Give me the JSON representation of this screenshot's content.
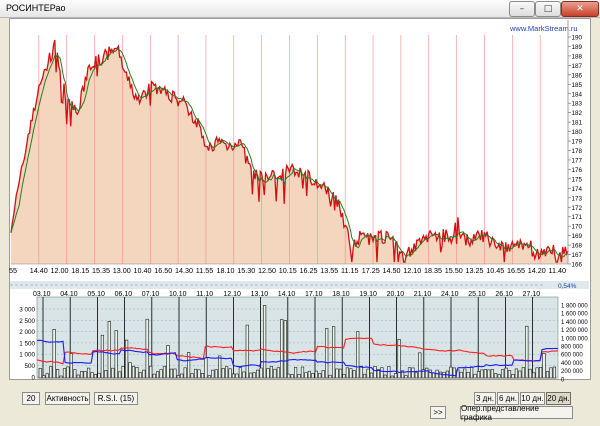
{
  "window": {
    "title": "РОСИНТЕРао"
  },
  "watermark": "www.MarkStream.ru",
  "percent_change": "0,54%",
  "price_chart": {
    "y_ticks": [
      "190",
      "189",
      "188",
      "187",
      "186",
      "185",
      "184",
      "183",
      "182",
      "181",
      "180",
      "179",
      "178",
      "177",
      "176",
      "175",
      "174",
      "173",
      "172",
      "171",
      "170",
      "169",
      "168",
      "167",
      "166"
    ],
    "x_labels": [
      "55",
      "14.40",
      "12.00",
      "18.15",
      "15.35",
      "13.00",
      "10.40",
      "16.50",
      "14.30",
      "11.55",
      "18.10",
      "15.30",
      "12.50",
      "10.15",
      "16.25",
      "13.55",
      "11.15",
      "17.25",
      "14.50",
      "12.10",
      "18.35",
      "15.50",
      "13.25",
      "10.45",
      "16.55",
      "14.20",
      "11.40"
    ]
  },
  "volume_chart": {
    "x_labels": [
      "03.10",
      "04.10",
      "05.10",
      "06.10",
      "07.10",
      "10.10",
      "11.10",
      "12.10",
      "13.10",
      "14.10",
      "17.10",
      "18.10",
      "19.10",
      "20.10",
      "21.10",
      "24.10",
      "25.10",
      "26.10",
      "27.10"
    ],
    "left_ticks": [
      "3 000",
      "2 500",
      "2 000",
      "1 500",
      "1 000",
      "500",
      "0"
    ],
    "right_ticks": [
      "1 800 000",
      "1 600 000",
      "1 400 000",
      "1 200 000",
      "1 000 000",
      "800 000",
      "600 000",
      "400 000",
      "200 000",
      "0"
    ]
  },
  "controls": {
    "period_value": "20",
    "activity_label": "Активность",
    "rsi_label": "R.S.I. (15)",
    "range_3d": "3 дн.",
    "range_6d": "6 дн.",
    "range_10d": "10 дн.",
    "range_20d": "20 дн.",
    "next_label": ">>",
    "view_label": "Опер.представление графика"
  },
  "colors": {
    "price_line": "#d01010",
    "price_fill": "#f3d6bd",
    "ma_line": "#2c7a22",
    "red_series": "#ff2020",
    "blue_series": "#1a1aff",
    "watermark": "#1f3fbf"
  }
}
